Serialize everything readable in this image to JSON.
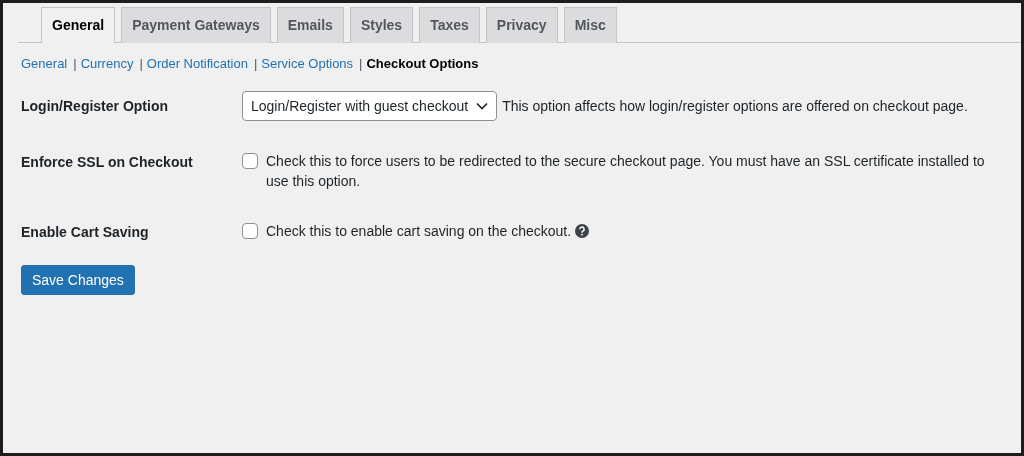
{
  "tabs": [
    {
      "label": "General",
      "selected": true
    },
    {
      "label": "Payment Gateways",
      "selected": false
    },
    {
      "label": "Emails",
      "selected": false
    },
    {
      "label": "Styles",
      "selected": false
    },
    {
      "label": "Taxes",
      "selected": false
    },
    {
      "label": "Privacy",
      "selected": false
    },
    {
      "label": "Misc",
      "selected": false
    }
  ],
  "subnav": {
    "separator": "|",
    "items": [
      {
        "label": "General",
        "selected": false
      },
      {
        "label": "Currency",
        "selected": false
      },
      {
        "label": "Order Notification",
        "selected": false
      },
      {
        "label": "Service Options",
        "selected": false
      },
      {
        "label": "Checkout Options",
        "selected": true
      }
    ]
  },
  "settings": [
    {
      "kind": "select",
      "label": "Login/Register Option",
      "value": "Login/Register with guest checkout",
      "description": "This option affects how login/register options are offered on checkout page."
    },
    {
      "kind": "checkbox",
      "label": "Enforce SSL on Checkout",
      "checked": false,
      "description": "Check this to force users to be redirected to the secure checkout page. You must have an SSL certificate installed to use this option.",
      "help": false
    },
    {
      "kind": "checkbox",
      "label": "Enable Cart Saving",
      "checked": false,
      "description": "Check this to enable cart saving on the checkout.",
      "help": true
    }
  ],
  "save_button": "Save Changes"
}
